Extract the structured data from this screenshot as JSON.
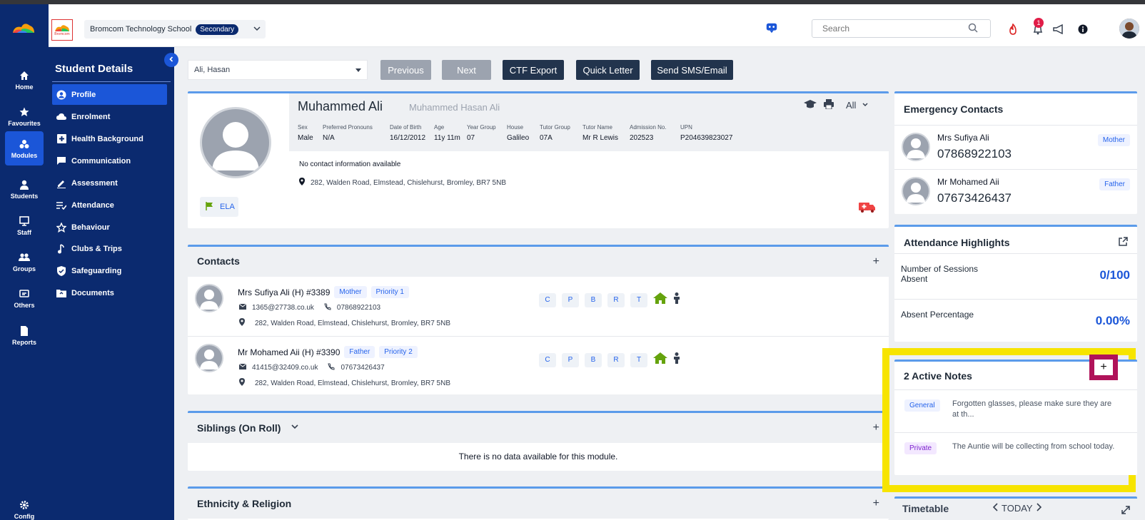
{
  "school": {
    "name": "Bromcom Technology School",
    "phase": "Secondary",
    "logo_text": "Bromcom"
  },
  "search": {
    "placeholder": "Search"
  },
  "notifications": {
    "count": "1"
  },
  "left_nav": {
    "items": [
      {
        "label": "Home",
        "icon": "home-icon"
      },
      {
        "label": "Favourites",
        "icon": "star-icon"
      },
      {
        "label": "Modules",
        "icon": "modules-icon",
        "active": true
      },
      {
        "label": "Students",
        "icon": "person-icon"
      },
      {
        "label": "Staff",
        "icon": "staff-icon"
      },
      {
        "label": "Groups",
        "icon": "groups-icon"
      },
      {
        "label": "Others",
        "icon": "others-icon"
      },
      {
        "label": "Reports",
        "icon": "reports-icon"
      },
      {
        "label": "Config",
        "icon": "gear-icon"
      }
    ]
  },
  "sub_nav": {
    "title": "Student Details",
    "items": [
      {
        "label": "Profile",
        "icon": "profile-icon",
        "active": true
      },
      {
        "label": "Enrolment",
        "icon": "cloud-icon"
      },
      {
        "label": "Health Background",
        "icon": "health-icon"
      },
      {
        "label": "Communication",
        "icon": "chat-icon"
      },
      {
        "label": "Assessment",
        "icon": "pencil-icon"
      },
      {
        "label": "Attendance",
        "icon": "list-check-icon"
      },
      {
        "label": "Behaviour",
        "icon": "star-outline-icon"
      },
      {
        "label": "Clubs & Trips",
        "icon": "music-icon"
      },
      {
        "label": "Safeguarding",
        "icon": "shield-icon"
      },
      {
        "label": "Documents",
        "icon": "folder-icon"
      }
    ]
  },
  "actions": {
    "student_value": "Ali, Hasan",
    "previous": "Previous",
    "next": "Next",
    "ctf_export": "CTF Export",
    "quick_letter": "Quick Letter",
    "send_sms": "Send SMS/Email"
  },
  "profile": {
    "name": "Muhammed Ali",
    "legal_name": "Muhammed Hasan Ali",
    "view_filter": "All",
    "fields": [
      {
        "label": "Sex",
        "value": "Male"
      },
      {
        "label": "Preferred Pronouns",
        "value": "N/A"
      },
      {
        "label": "Date of Birth",
        "value": "16/12/2012"
      },
      {
        "label": "Age",
        "value": "11y 11m"
      },
      {
        "label": "Year Group",
        "value": "07"
      },
      {
        "label": "House",
        "value": "Galileo"
      },
      {
        "label": "Tutor Group",
        "value": "07A"
      },
      {
        "label": "Tutor Name",
        "value": "Mr R Lewis"
      },
      {
        "label": "Admission No.",
        "value": "202523"
      },
      {
        "label": "UPN",
        "value": "P204639823027"
      }
    ],
    "contact_info": "No contact information available",
    "address": "282, Walden Road, Elmstead, Chislehurst, Bromley, BR7 5NB",
    "ela_label": "ELA"
  },
  "contacts": {
    "title": "Contacts",
    "add": "+",
    "items": [
      {
        "name": "Mrs Sufiya Ali (H) #3389",
        "relation": "Mother",
        "priority": "Priority 1",
        "email": "1365@27738.co.uk",
        "phone": "07868922103",
        "address": "282, Walden Road, Elmstead, Chislehurst, Bromley, BR7 5NB"
      },
      {
        "name": "Mr Mohamed Aii (H) #3390",
        "relation": "Father",
        "priority": "Priority 2",
        "email": "41415@32409.co.uk",
        "phone": "07673426437",
        "address": "282, Walden Road, Elmstead, Chislehurst, Bromley, BR7 5NB"
      }
    ],
    "flags": [
      "C",
      "P",
      "B",
      "R",
      "T"
    ]
  },
  "siblings": {
    "title": "Siblings  (On Roll)",
    "add": "+",
    "empty": "There is no data available for this module."
  },
  "ethnicity": {
    "title": "Ethnicity & Religion",
    "add": "+"
  },
  "emergency": {
    "title": "Emergency Contacts",
    "items": [
      {
        "name": "Mrs Sufiya Ali",
        "phone": "07868922103",
        "relation": "Mother"
      },
      {
        "name": "Mr Mohamed Aii",
        "phone": "07673426437",
        "relation": "Father"
      }
    ]
  },
  "attendance": {
    "title": "Attendance Highlights",
    "items": [
      {
        "label": "Number of Sessions Absent",
        "value": "0/100"
      },
      {
        "label": "Absent Percentage",
        "value": "0.00%"
      }
    ]
  },
  "notes": {
    "title": "2 Active Notes",
    "add": "+",
    "items": [
      {
        "type": "General",
        "text": "Forgotten glasses, please make sure they are at th..."
      },
      {
        "type": "Private",
        "text": "The Auntie will be collecting from school today."
      }
    ]
  },
  "timetable": {
    "title": "Timetable",
    "nav": "TODAY"
  },
  "colors": {
    "nav_bg": "#0b2a6f",
    "accent": "#1b56d8",
    "highlight": "#f7e400",
    "focus": "#b0135a"
  }
}
